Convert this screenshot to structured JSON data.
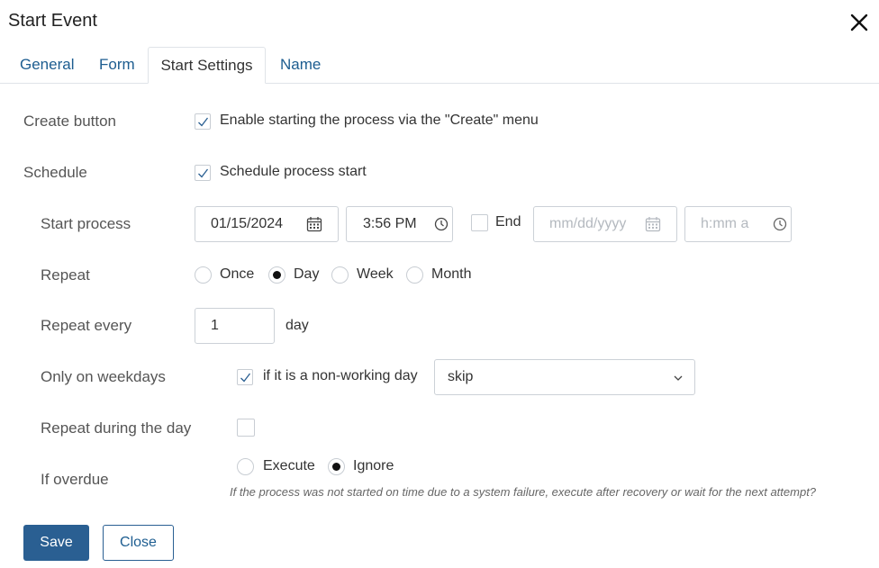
{
  "dialog": {
    "title": "Start Event"
  },
  "tabs": [
    {
      "label": "General"
    },
    {
      "label": "Form"
    },
    {
      "label": "Start Settings",
      "active": true
    },
    {
      "label": "Name"
    }
  ],
  "create_button": {
    "label": "Create button",
    "checkbox_label": "Enable starting the process via the \"Create\" menu",
    "checked": true
  },
  "schedule": {
    "label": "Schedule",
    "checkbox_label": "Schedule process start",
    "checked": true
  },
  "start_process": {
    "label": "Start process",
    "date_value": "01/15/2024",
    "time_value": "3:56 PM",
    "end_label": "End",
    "end_checked": false,
    "end_date_placeholder": "mm/dd/yyyy",
    "end_time_placeholder": "h:mm a"
  },
  "repeat": {
    "label": "Repeat",
    "options": [
      "Once",
      "Day",
      "Week",
      "Month"
    ],
    "selected": "Day"
  },
  "repeat_every": {
    "label": "Repeat every",
    "value": "1",
    "unit": "day"
  },
  "weekdays": {
    "label": "Only on weekdays",
    "checkbox_label": "if it is a non-working day",
    "checked": true,
    "select_value": "skip"
  },
  "repeat_during_day": {
    "label": "Repeat during the day",
    "checked": false
  },
  "overdue": {
    "label": "If overdue",
    "options": [
      "Execute",
      "Ignore"
    ],
    "selected": "Ignore",
    "hint": "If the process was not started on time due to a system failure, execute after recovery or wait for the next attempt?"
  },
  "buttons": {
    "save": "Save",
    "close": "Close"
  },
  "colors": {
    "primary": "#2a5f92",
    "link": "#1d5d90",
    "border": "#ccd1d7"
  },
  "icons": [
    "close-icon",
    "checkmark-icon",
    "calendar-icon",
    "clock-icon",
    "chevron-down-icon"
  ]
}
